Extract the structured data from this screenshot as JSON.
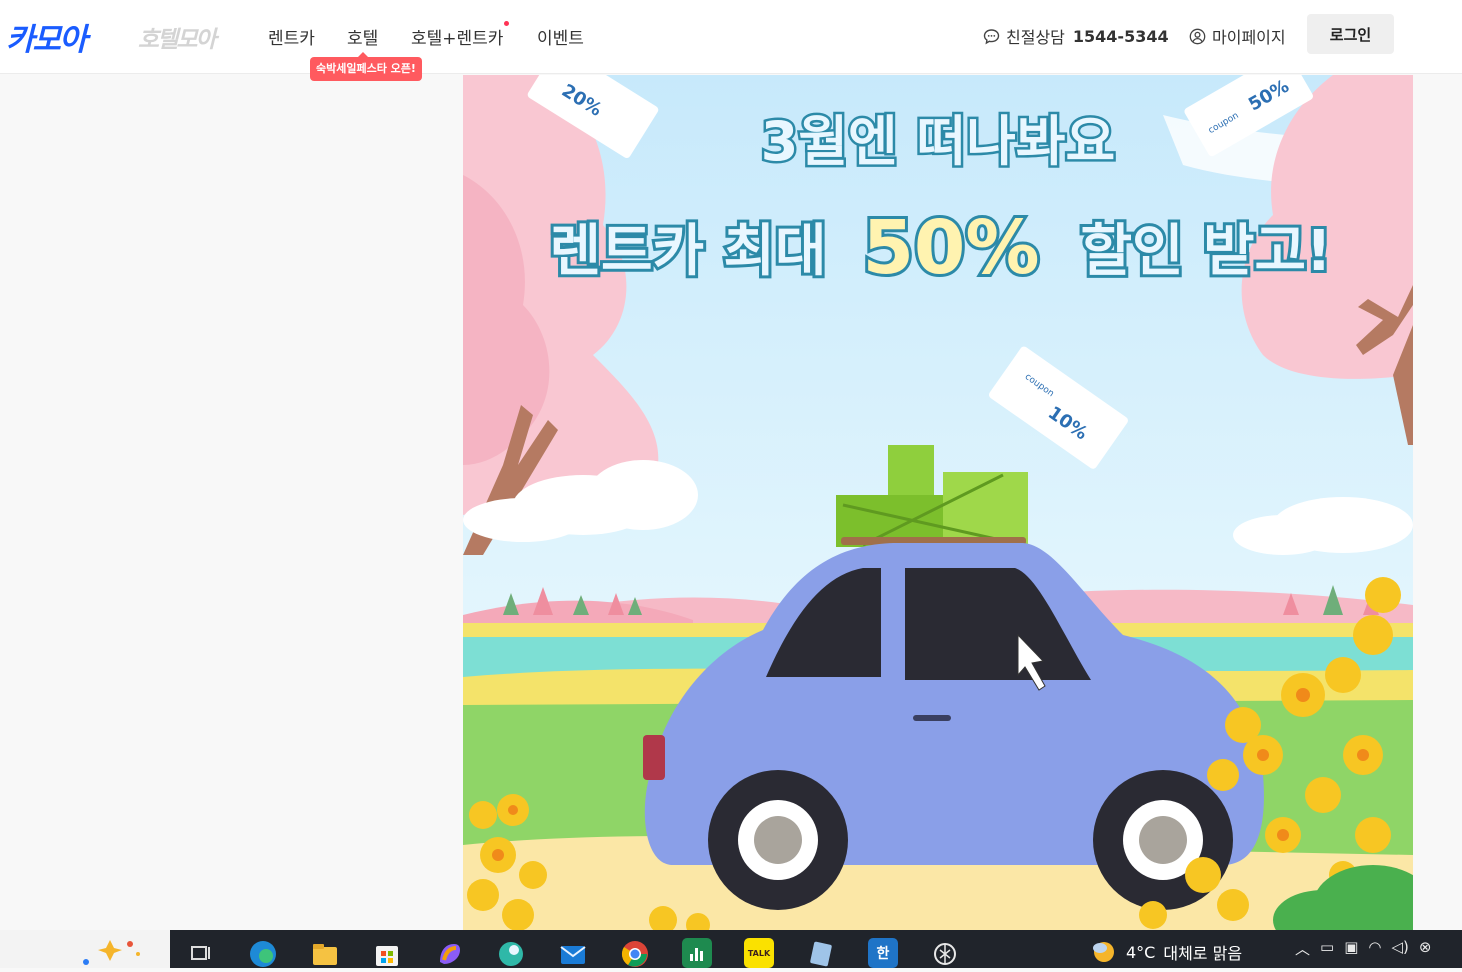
{
  "header": {
    "logo_main": "카모아",
    "logo_sub": "호텔모아",
    "nav": [
      {
        "label": "렌트카"
      },
      {
        "label": "호텔"
      },
      {
        "label": "호텔+렌트카"
      },
      {
        "label": "이벤트"
      }
    ],
    "hotel_badge": "숙박세일페스타 오픈!",
    "cs_label": "친절상담",
    "cs_phone": "1544-5344",
    "mypage": "마이페이지",
    "login": "로그인"
  },
  "banner": {
    "headline_1": "3월엔 떠나봐요",
    "headline_2_prefix": "렌트카 최대",
    "headline_2_highlight": "50%",
    "headline_2_suffix": "할인 받고!",
    "tickets": [
      {
        "label": "20%"
      },
      {
        "label": "coupon",
        "value": "50%"
      },
      {
        "label": "coupon",
        "value": "10%"
      }
    ]
  },
  "taskbar": {
    "weather_temp": "4°C",
    "weather_text": "대체로 맑음",
    "apps": [
      "task-view",
      "edge",
      "file-explorer",
      "microsoft-store",
      "copilot",
      "app",
      "mail",
      "chrome",
      "excel",
      "kakaotalk",
      "notes",
      "hangul",
      "chatgpt"
    ],
    "kakaotalk_label": "TALK",
    "hangul_label": "한"
  },
  "colors": {
    "brand": "#1a5cff",
    "badge": "#ff5a5f",
    "sky": "#cfeefd",
    "car": "#8a9fe8",
    "headline": "#2c8aa8",
    "highlight": "#fff3b0"
  }
}
